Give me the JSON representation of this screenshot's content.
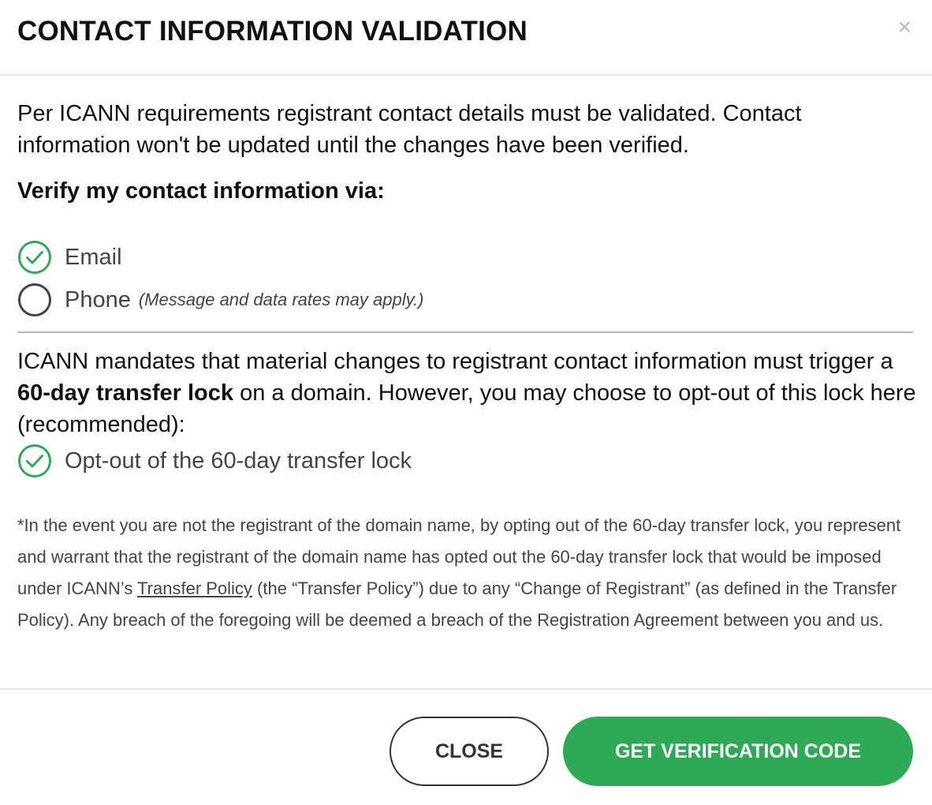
{
  "dialog": {
    "title": "CONTACT INFORMATION VALIDATION",
    "close_glyph": "×"
  },
  "intro_text": "Per ICANN requirements registrant contact details must be validated. Contact information won't be updated until the changes have been verified.",
  "verify_heading": "Verify my contact information via:",
  "verify_options": [
    {
      "label": "Email",
      "note": "",
      "selected": true
    },
    {
      "label": "Phone",
      "note": "(Message and data rates may apply.)",
      "selected": false
    }
  ],
  "lock_notice": {
    "before": "ICANN mandates that material changes to registrant contact information must trigger a ",
    "emphasis": "60-day transfer lock",
    "after": " on a domain. However, you may choose to opt-out of this lock here (recommended):"
  },
  "optout": {
    "label": "Opt-out of the 60-day transfer lock",
    "checked": true
  },
  "disclaimer": {
    "before": "*In the event you are not the registrant of the domain name, by opting out of the 60-day transfer lock, you represent and warrant that the registrant of the domain name has opted out the 60-day transfer lock that would be imposed under ICANN’s ",
    "link": "Transfer Policy",
    "after": " (the “Transfer Policy”) due to any “Change of Registrant” (as defined in the Transfer Policy). Any breach of the foregoing will be deemed a breach of the Registration Agreement between you and us."
  },
  "buttons": {
    "close_label": "CLOSE",
    "verify_label": "GET VERIFICATION CODE"
  },
  "colors": {
    "accent_green": "#2eaa57",
    "radio_unselected": "#444444",
    "close_icon": "#b9b9b9"
  },
  "icons": {
    "close": "close-icon",
    "selected": "check-circle-icon",
    "unselected": "empty-circle-icon"
  }
}
